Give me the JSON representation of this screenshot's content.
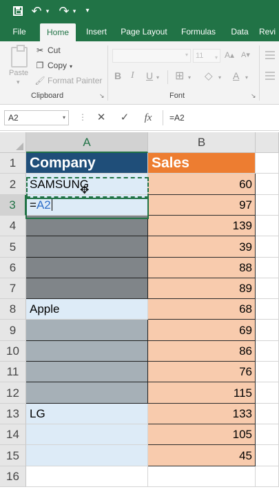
{
  "qat": {
    "save": "save-icon",
    "undo": "undo-icon",
    "redo": "redo-icon",
    "customize": "customize-qat-icon"
  },
  "tabs": [
    {
      "label": "File",
      "active": false
    },
    {
      "label": "Home",
      "active": true
    },
    {
      "label": "Insert",
      "active": false
    },
    {
      "label": "Page Layout",
      "active": false
    },
    {
      "label": "Formulas",
      "active": false
    },
    {
      "label": "Data",
      "active": false
    },
    {
      "label": "Revi",
      "active": false
    }
  ],
  "clipboard": {
    "paste": "Paste",
    "cut": "Cut",
    "copy": "Copy",
    "format_painter": "Format Painter",
    "group_label": "Clipboard"
  },
  "font": {
    "name": "",
    "size": "11",
    "group_label": "Font"
  },
  "formula_bar": {
    "name_box": "A2",
    "cancel_icon": "✕",
    "enter_icon": "✓",
    "function_icon": "fx",
    "formula": "=A2"
  },
  "columns": [
    "A",
    "B"
  ],
  "colors": {
    "excel_green": "#217346",
    "header_company": "#1f4e79",
    "header_sales": "#ed7d31",
    "light_blue": "#ddebf7",
    "dark_gray": "#808589",
    "medium_gray": "#a6b0b7",
    "peach": "#f8cbad",
    "reference_blue": "#2f6fc9"
  },
  "rows": [
    {
      "num": "1",
      "a": "Company",
      "b": "Sales"
    },
    {
      "num": "2",
      "a": "SAMSUNG",
      "b": "60"
    },
    {
      "num": "3",
      "a": "=A2",
      "b": "97"
    },
    {
      "num": "4",
      "a": "",
      "b": "139"
    },
    {
      "num": "5",
      "a": "",
      "b": "39"
    },
    {
      "num": "6",
      "a": "",
      "b": "88"
    },
    {
      "num": "7",
      "a": "",
      "b": "89"
    },
    {
      "num": "8",
      "a": "Apple",
      "b": "68"
    },
    {
      "num": "9",
      "a": "",
      "b": "69"
    },
    {
      "num": "10",
      "a": "",
      "b": "86"
    },
    {
      "num": "11",
      "a": "",
      "b": "76"
    },
    {
      "num": "12",
      "a": "",
      "b": "115"
    },
    {
      "num": "13",
      "a": "LG",
      "b": "133"
    },
    {
      "num": "14",
      "a": "",
      "b": "105"
    },
    {
      "num": "15",
      "a": "",
      "b": "45"
    },
    {
      "num": "16",
      "a": "",
      "b": ""
    }
  ]
}
